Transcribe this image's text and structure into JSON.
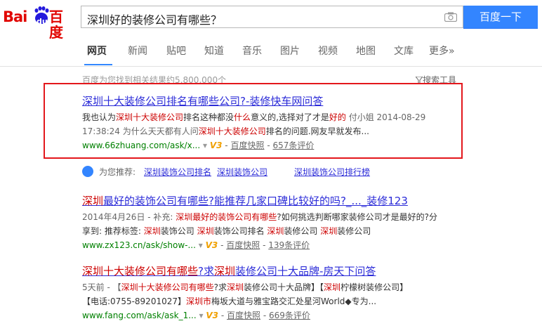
{
  "logo": {
    "bai": "Bai",
    "du": "du",
    "cn": "百度"
  },
  "search": {
    "query": "深圳好的装修公司有哪些？",
    "button": "百度一下"
  },
  "nav": {
    "tabs": [
      "网页",
      "新闻",
      "贴吧",
      "知道",
      "音乐",
      "图片",
      "视频",
      "地图",
      "文库",
      "更多»"
    ]
  },
  "count": "百度为您找到相关结果约5,800,000个",
  "tools": "搜索工具",
  "results": [
    {
      "title": "深圳十大装修公司排名有哪些公司?-装修快车网问答",
      "abs1": [
        "我也认为",
        "深圳十大装修公司",
        "排名这种都没",
        "什么",
        "意义的,选择对了才是",
        "好的",
        " 付小姐 2014-08-29"
      ],
      "abs2": [
        "17:38:24 为什么天天都有人问",
        "深圳十大装修公司",
        "排名的问题.网友早就发布..."
      ],
      "url": "www.66zhuang.com/ask/x...",
      "snap": "百度快照",
      "reviews": "657条评价"
    },
    {
      "title": [
        "深圳",
        "最好的装饰公司有哪些",
        "?能推荐几家口碑比较好的吗?_..._装修123"
      ],
      "abs1": [
        "2014年4月26日 - 补充: ",
        "深圳最好的装饰公司有哪些",
        "?如何挑选判断哪家装修公司才是最好的?分"
      ],
      "abs2": [
        "享到: 推荐标签: ",
        "深圳",
        "装饰公司 ",
        "深圳",
        "装饰公司排名 ",
        "深圳",
        "装修公司 ",
        "深圳",
        "装修公司"
      ],
      "url": "www.zx123.cn/ask/show-...",
      "snap": "百度快照",
      "reviews": "139条评价"
    },
    {
      "title": [
        "深圳十大装修公司有哪些",
        "?求",
        "深圳",
        "装修公司十大品牌-房天下问答"
      ],
      "abs1": [
        "5天前 - 【",
        "深圳十大装修公司有哪些",
        "?求",
        "深圳",
        "装修公司十大品牌】",
        "【",
        "深圳",
        "柠檬树装修公司】"
      ],
      "abs2": [
        "【电话:0755-89201027】",
        "深圳市",
        "梅坂大道与雅宝路交汇处星河World◆专为..."
      ],
      "url": "www.fang.com/ask/ask_1...",
      "snap": "百度快照",
      "reviews": "669条评价"
    }
  ],
  "recommend": {
    "label": "为您推荐:",
    "items": [
      "深圳装饰公司排名",
      "深圳装饰公司",
      "深圳装饰公司排行榜"
    ]
  },
  "colors": {
    "accent": "#3385ff",
    "highlight": "#cc0000",
    "url": "#008000",
    "box": "#e3171c"
  }
}
